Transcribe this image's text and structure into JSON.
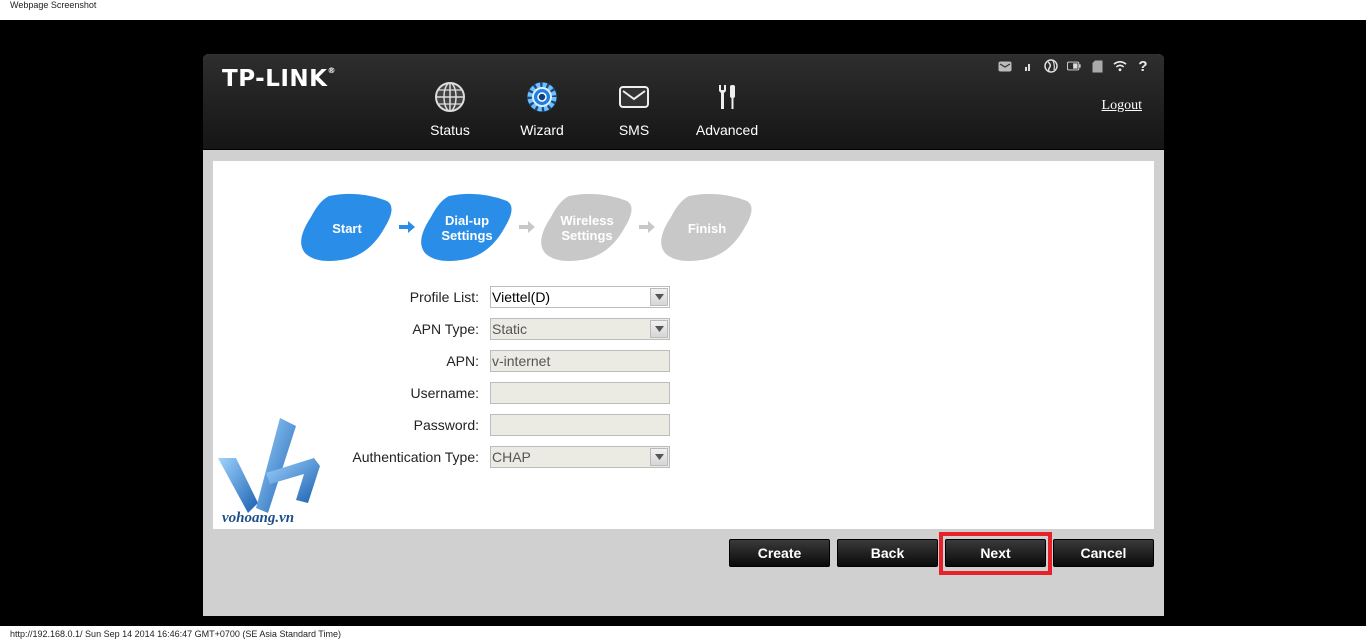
{
  "captions": {
    "top": "Webpage Screenshot",
    "bottom": "http://192.168.0.1/ Sun Sep 14 2014 16:46:47 GMT+0700 (SE Asia Standard Time)"
  },
  "header": {
    "logo": "TP-LINK",
    "logo_mark": "®",
    "logout": "Logout",
    "nav": [
      {
        "label": "Status",
        "icon": "globe-icon"
      },
      {
        "label": "Wizard",
        "icon": "gear-icon"
      },
      {
        "label": "SMS",
        "icon": "envelope-icon"
      },
      {
        "label": "Advanced",
        "icon": "tools-icon"
      }
    ],
    "status_icons": [
      "mail-icon",
      "signal-icon",
      "internet-globe-icon",
      "battery-icon",
      "sd-card-icon",
      "wifi-icon",
      "help-icon"
    ]
  },
  "steps": [
    {
      "label_line1": "Start",
      "label_line2": "",
      "state": "done"
    },
    {
      "label_line1": "Dial-up",
      "label_line2": "Settings",
      "state": "active"
    },
    {
      "label_line1": "Wireless",
      "label_line2": "Settings",
      "state": "pending"
    },
    {
      "label_line1": "Finish",
      "label_line2": "",
      "state": "pending"
    }
  ],
  "form": {
    "profile_list": {
      "label": "Profile List:",
      "value": "Viettel(D)"
    },
    "apn_type": {
      "label": "APN Type:",
      "value": "Static"
    },
    "apn": {
      "label": "APN:",
      "value": "v-internet"
    },
    "username": {
      "label": "Username:",
      "value": ""
    },
    "password": {
      "label": "Password:",
      "value": ""
    },
    "auth_type": {
      "label": "Authentication Type:",
      "value": "CHAP"
    }
  },
  "buttons": {
    "create": "Create",
    "back": "Back",
    "next": "Next",
    "cancel": "Cancel"
  },
  "watermark": {
    "text": "vohoang.vn"
  },
  "colors": {
    "accent_blue": "#2a8ee8",
    "pending_gray": "#c8c8c8",
    "highlight_red": "#e8202a"
  }
}
